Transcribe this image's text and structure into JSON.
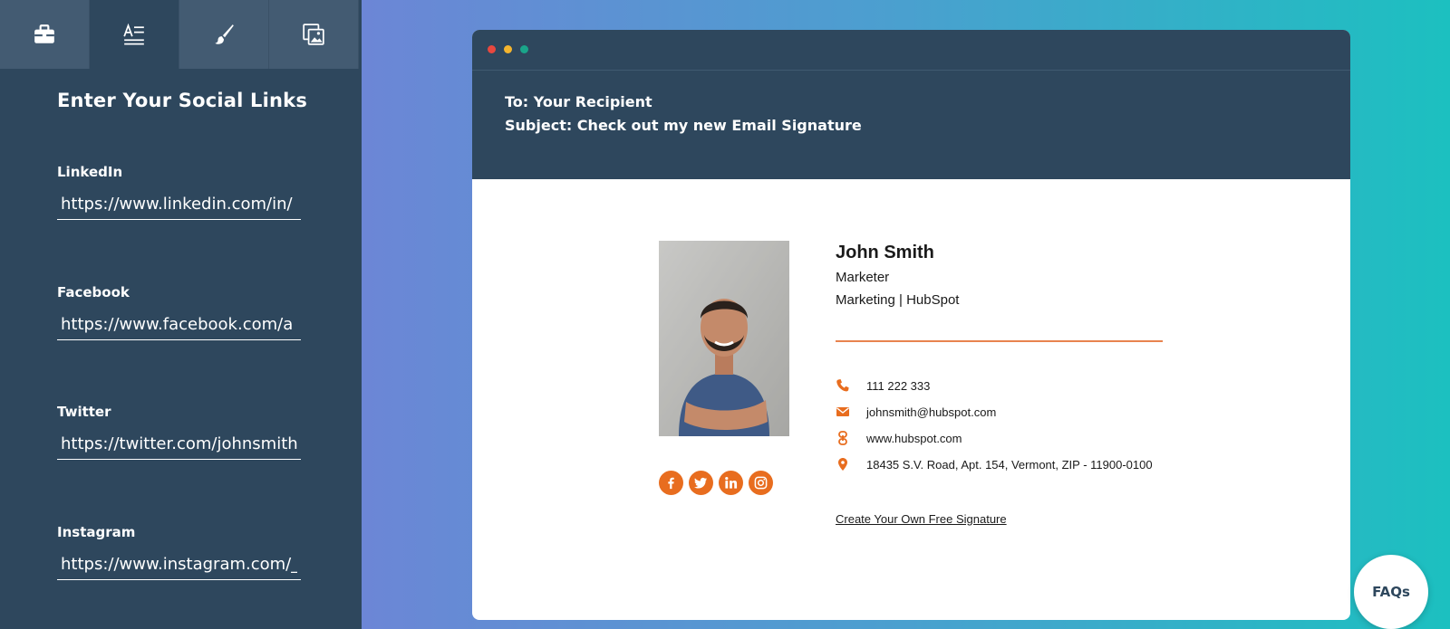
{
  "sidebar": {
    "tabs": [
      {
        "name": "briefcase-icon"
      },
      {
        "name": "text-format-icon",
        "active": true
      },
      {
        "name": "paintbrush-icon"
      },
      {
        "name": "image-icon"
      }
    ],
    "title": "Enter Your Social Links",
    "fields": [
      {
        "label": "LinkedIn",
        "value": "https://www.linkedin.com/in/"
      },
      {
        "label": "Facebook",
        "value": "https://www.facebook.com/a"
      },
      {
        "label": "Twitter",
        "value": "https://twitter.com/johnsmith"
      },
      {
        "label": "Instagram",
        "value": "https://www.instagram.com/_"
      }
    ]
  },
  "email": {
    "to": "To: Your Recipient",
    "subject": "Subject: Check out my new Email Signature"
  },
  "signature": {
    "name": "John Smith",
    "title": "Marketer",
    "company": "Marketing | HubSpot",
    "phone": "111 222 333",
    "email": "johnsmith@hubspot.com",
    "website": "www.hubspot.com",
    "address": "18435 S.V. Road, Apt. 154, Vermont, ZIP - 11900-0100",
    "cta_link": "Create Your Own Free Signature",
    "accent_color": "#e86d1f",
    "social_icons": [
      "facebook-icon",
      "twitter-icon",
      "linkedin-icon",
      "instagram-icon"
    ]
  },
  "faq_label": "FAQs",
  "colors": {
    "sidebar_bg": "#2e475d",
    "gradient_start": "#6c86d6",
    "gradient_end": "#1cc0c0"
  }
}
